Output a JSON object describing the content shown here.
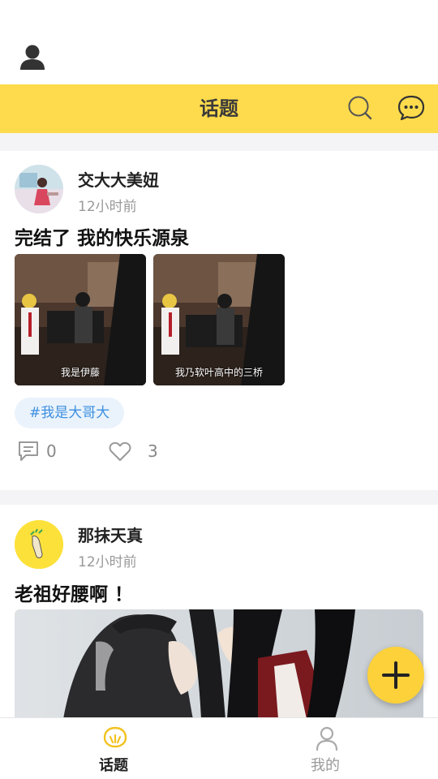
{
  "header": {
    "title": "话题"
  },
  "posts": [
    {
      "username": "交大大美妞",
      "time": "12小时前",
      "title": "完结了 我的快乐源泉",
      "images": [
        {
          "caption": "我是伊藤"
        },
        {
          "caption": "我乃软叶高中的三桥"
        }
      ],
      "tag": "#我是大哥大",
      "comments": "0",
      "likes": "3"
    },
    {
      "username": "那抹天真",
      "time": "12小时前",
      "title": "老祖好腰啊 ！"
    }
  ],
  "tabbar": {
    "tabs": [
      {
        "label": "话题",
        "active": true
      },
      {
        "label": "我的",
        "active": false
      }
    ]
  },
  "colors": {
    "accent": "#fedb4c",
    "tag_text": "#3d8fe0",
    "tag_bg": "#eaf3fc"
  }
}
